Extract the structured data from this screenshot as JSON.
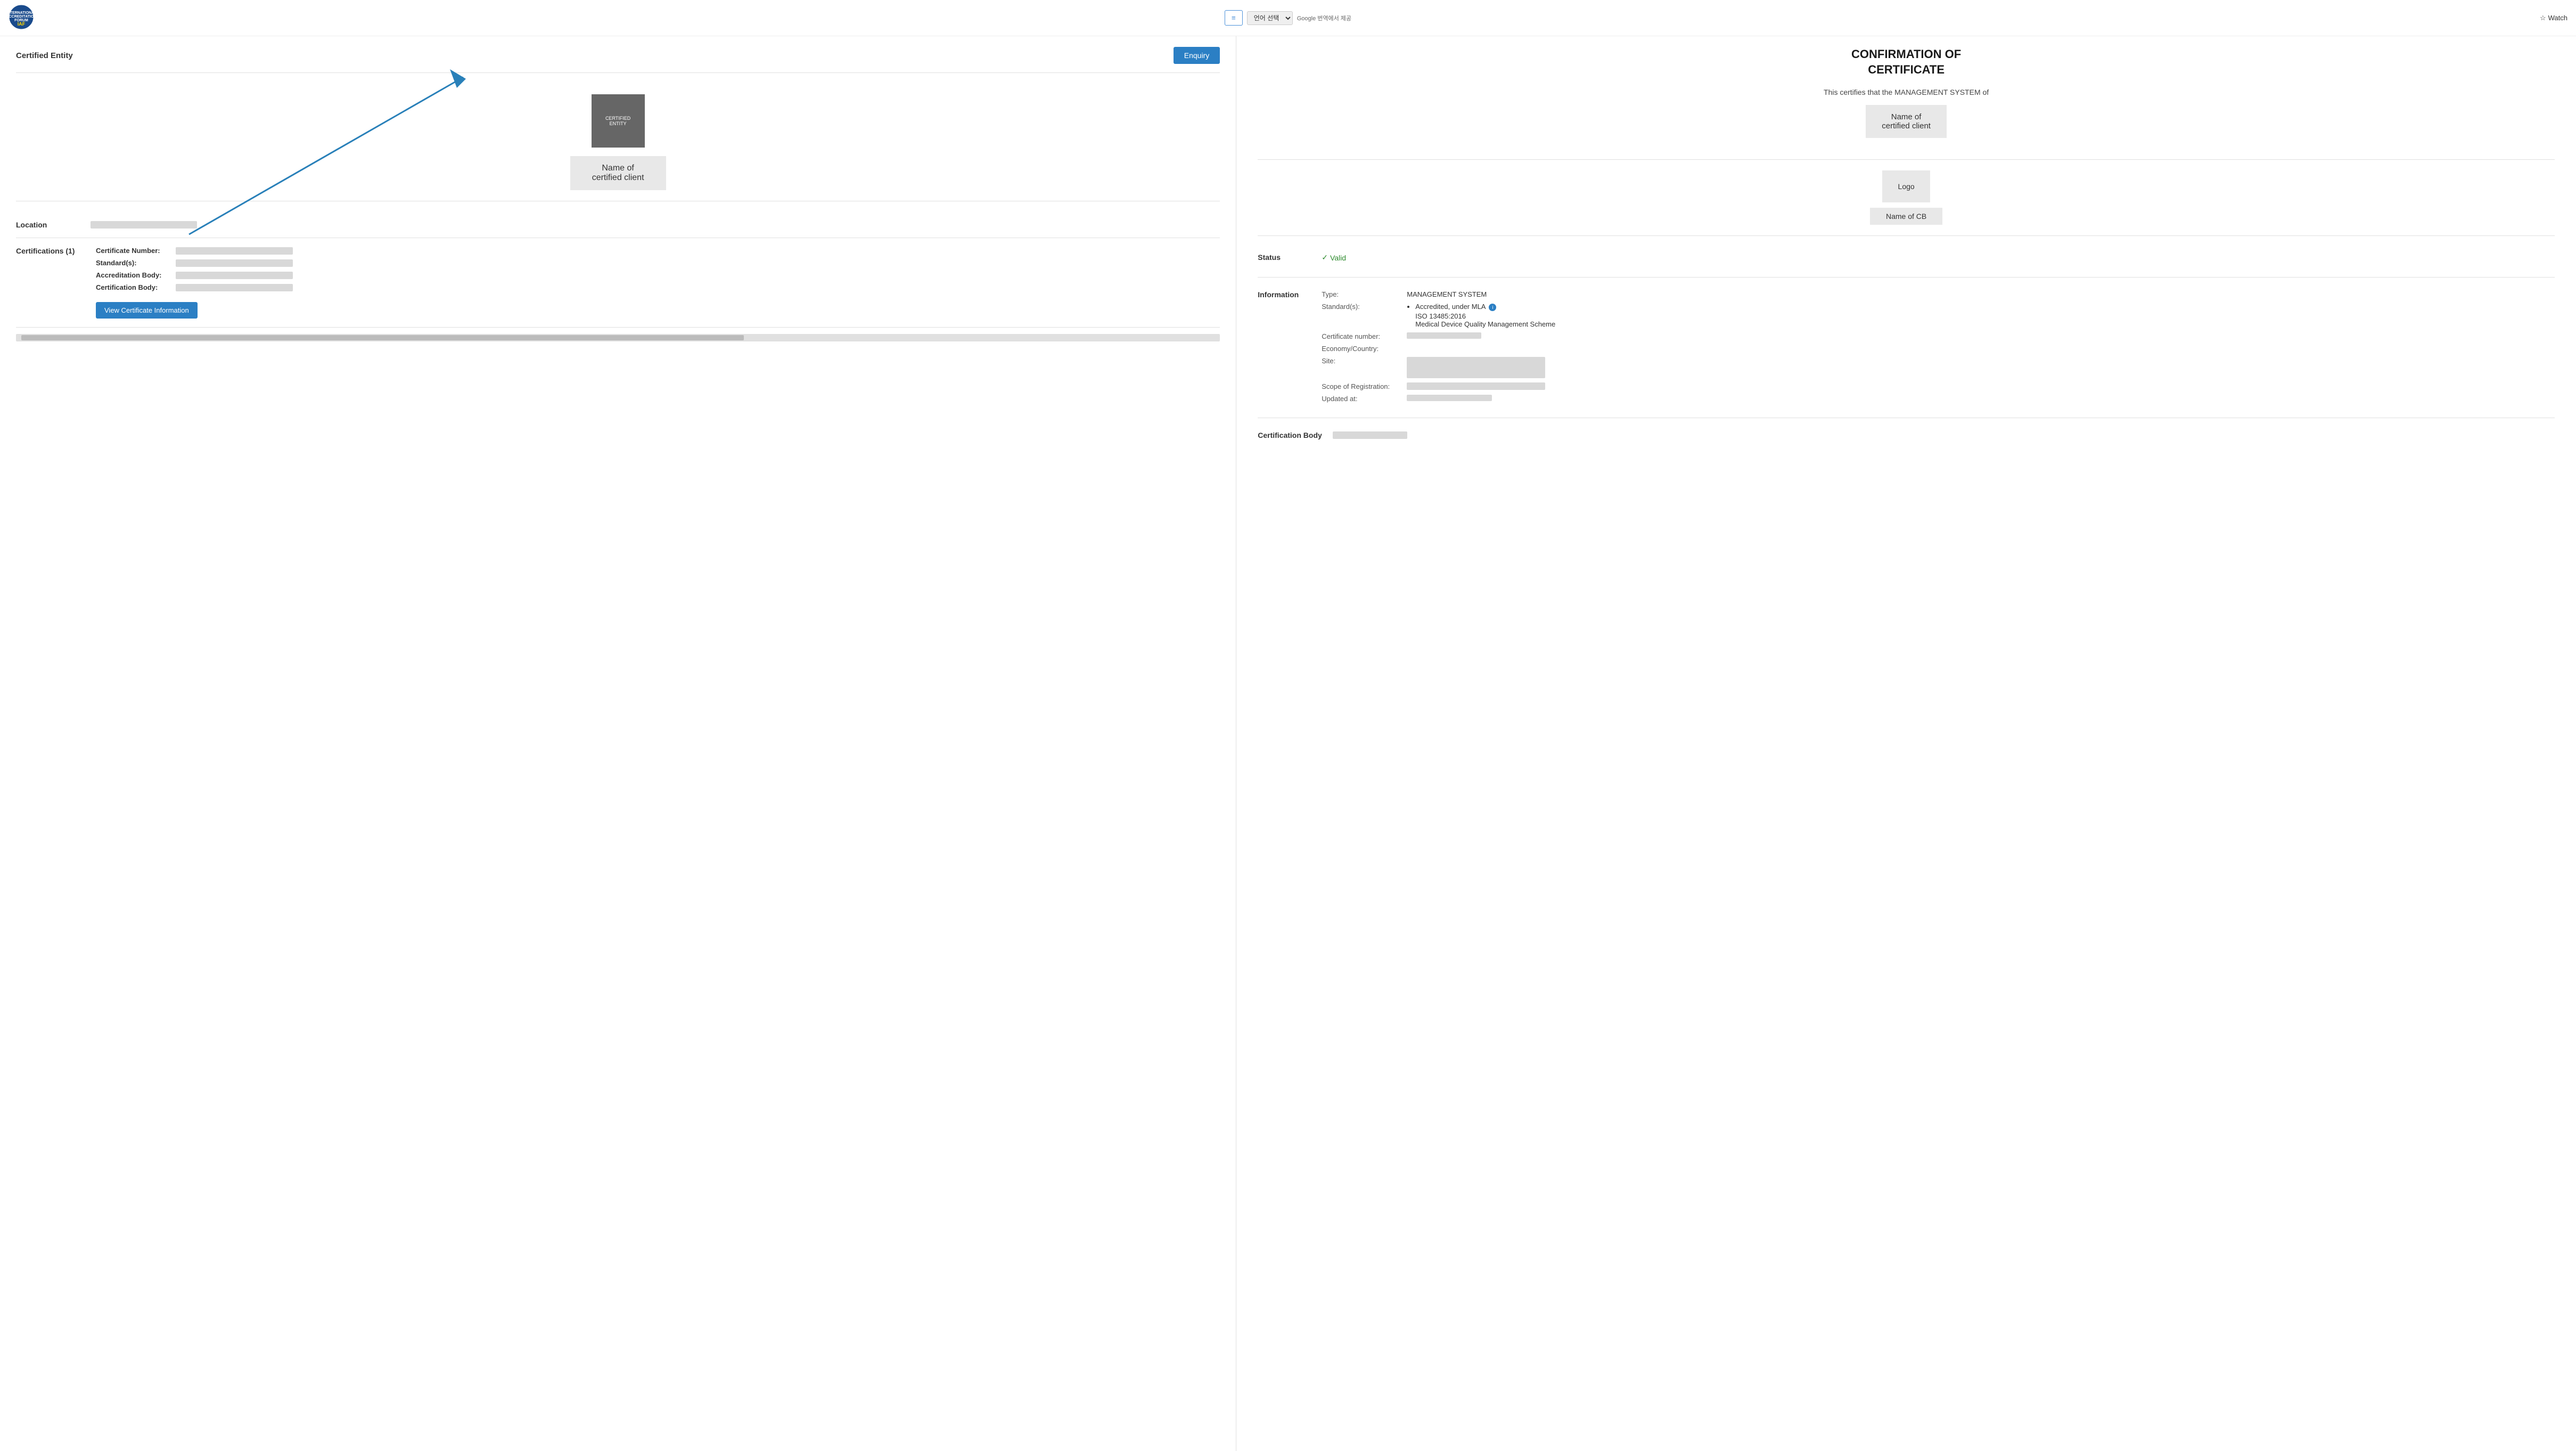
{
  "nav": {
    "hamburger_icon": "≡",
    "lang_placeholder": "언어 선택",
    "google_translate_label": "Google 번역에서 제공",
    "watch_label": "Watch",
    "watch_star": "☆"
  },
  "left_panel": {
    "certified_entity_label": "Certified Entity",
    "enquiry_label": "Enquiry",
    "entity_logo_text": "CERTIFIED\nENTITY",
    "entity_name": "Name of\ncertified client",
    "location_label": "Location",
    "certifications_label": "Certifications (1)",
    "cert_number_label": "Certificate Number:",
    "standards_label": "Standard(s):",
    "accreditation_label": "Accreditation Body:",
    "cert_body_label": "Certification Body:",
    "view_cert_btn": "View Certificate Information"
  },
  "right_panel": {
    "title_line1": "CONFIRMATION OF",
    "title_line2": "CERTIFICATE",
    "certifies_text": "This certifies that the MANAGEMENT SYSTEM of",
    "client_name": "Name of\ncertified client",
    "logo_label": "Logo",
    "cb_name": "Name of CB",
    "status_label": "Status",
    "status_value": "Valid",
    "info_label": "Information",
    "type_label": "Type:",
    "type_value": "MANAGEMENT SYSTEM",
    "standards_label": "Standard(s):",
    "accredited_label": "Accredited, under MLA",
    "iso_text": "ISO 13485:2016",
    "scheme_text": "Medical Device Quality Management Scheme",
    "cert_number_label": "Certificate number:",
    "economy_label": "Economy/Country:",
    "site_label": "Site:",
    "scope_label": "Scope of Registration:",
    "updated_label": "Updated at:",
    "cert_body_section_label": "Certification Body"
  }
}
